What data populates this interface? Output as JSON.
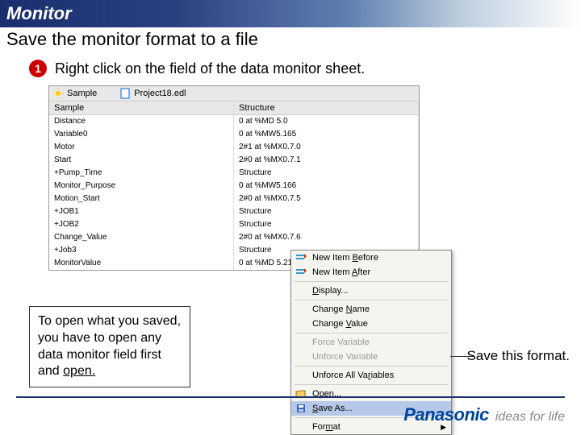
{
  "header": {
    "title": "Monitor",
    "subtitle": "Save the monitor format to a file"
  },
  "step": {
    "number": "1",
    "text": "Right click on the field of the data monitor sheet."
  },
  "screenshot": {
    "toolbar": {
      "label": "Sample",
      "tab": "Project18.edl"
    },
    "columns": [
      "Sample",
      "Structure"
    ],
    "rows": [
      {
        "c0": "Distance",
        "c1": "0 at %MD 5.0"
      },
      {
        "c0": "Variable0",
        "c1": "0 at %MW5.165"
      },
      {
        "c0": "Motor",
        "c1": "2#1 at %MX0.7.0"
      },
      {
        "c0": "Start",
        "c1": "2#0 at %MX0.7.1"
      },
      {
        "c0": "+Pump_Time",
        "c1": "Structure"
      },
      {
        "c0": "Monitor_Purpose",
        "c1": "0 at %MW5.166"
      },
      {
        "c0": "Motion_Start",
        "c1": "2#0 at %MX0.7.5"
      },
      {
        "c0": "+JOB1",
        "c1": "Structure"
      },
      {
        "c0": "+JOB2",
        "c1": "Structure"
      },
      {
        "c0": "Change_Value",
        "c1": "2#0 at %MX0.7.6"
      },
      {
        "c0": "+Job3",
        "c1": "Structure"
      },
      {
        "c0": "MonitorValue",
        "c1": "0 at %MD 5.213"
      }
    ]
  },
  "note": {
    "line1": "To open what you saved, you have to open any data monitor field first and ",
    "underlined": "open."
  },
  "callout": {
    "text": "Save this format."
  },
  "context_menu": {
    "items": [
      {
        "icon": "insert-before-icon",
        "label_pre": "New Item ",
        "u": "B",
        "label_post": "efore",
        "interact": true
      },
      {
        "icon": "insert-after-icon",
        "label_pre": "New Item ",
        "u": "A",
        "label_post": "fter",
        "interact": true
      },
      {
        "sep": true
      },
      {
        "icon": "",
        "label_pre": "",
        "u": "D",
        "label_post": "isplay...",
        "interact": true
      },
      {
        "sep": true
      },
      {
        "icon": "",
        "label_pre": "Change ",
        "u": "N",
        "label_post": "ame",
        "interact": true
      },
      {
        "icon": "",
        "label_pre": "Change ",
        "u": "V",
        "label_post": "alue",
        "interact": true
      },
      {
        "sep": true
      },
      {
        "icon": "",
        "label_pre": "F",
        "u": "",
        "label_post": "orce Variable",
        "disabled": true
      },
      {
        "icon": "",
        "label_pre": "Unf",
        "u": "",
        "label_post": "orce Variable",
        "disabled": true
      },
      {
        "sep": true
      },
      {
        "icon": "",
        "label_pre": "Unforce All Va",
        "u": "r",
        "label_post": "iables",
        "interact": true
      },
      {
        "sep": true
      },
      {
        "icon": "open-icon",
        "label_pre": "",
        "u": "O",
        "label_post": "pen...",
        "interact": true
      },
      {
        "icon": "save-icon",
        "label_pre": "",
        "u": "S",
        "label_post": "ave As...",
        "highlight": true,
        "interact": true
      },
      {
        "sep": true
      },
      {
        "icon": "",
        "label_pre": "For",
        "u": "m",
        "label_post": "at",
        "arrow": true,
        "interact": true
      }
    ]
  },
  "footer": {
    "brand": "Panasonic",
    "tagline": "ideas for life"
  }
}
